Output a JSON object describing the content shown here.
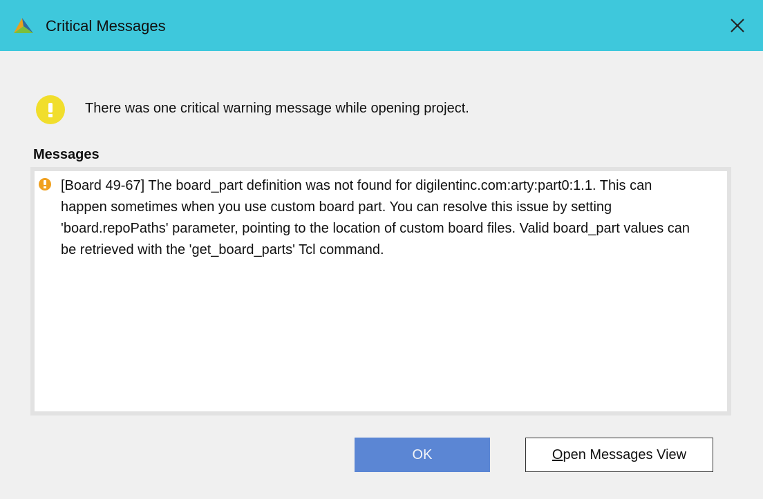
{
  "window": {
    "title": "Critical Messages",
    "logo_icon": "vivado-logo-icon",
    "close_icon": "close-icon",
    "titlebar_color": "#3ec8dc"
  },
  "summary": {
    "icon": "warning-icon",
    "text": "There was one critical warning message while opening project."
  },
  "messages": {
    "heading": "Messages",
    "items": [
      {
        "icon": "critical-warning-icon",
        "text": "[Board 49-67] The board_part definition was not found for digilentinc.com:arty:part0:1.1. This can happen sometimes when you use custom board part. You can resolve this issue by setting 'board.repoPaths' parameter, pointing to the location of custom board files. Valid board_part values can be retrieved with the 'get_board_parts' Tcl command."
      }
    ]
  },
  "buttons": {
    "ok_label": "OK",
    "open_messages_mnemonic": "O",
    "open_messages_rest": "pen Messages View"
  },
  "colors": {
    "ok_button": "#5b86d4",
    "warning": "#f1de2c",
    "critical": "#f0a01e"
  }
}
